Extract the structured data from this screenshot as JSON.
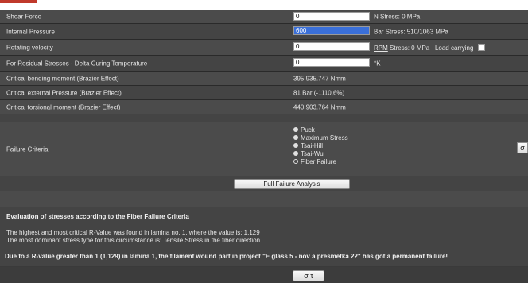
{
  "rows": {
    "shear_force": {
      "label": "Shear Force",
      "value": "0",
      "suffix": "N Stress: 0 MPa"
    },
    "internal_pressure": {
      "label": "Internal Pressure",
      "value": "600",
      "suffix": "Bar Stress: 510/1063 MPa"
    },
    "rotating_velocity": {
      "label": "Rotating velocity",
      "value": "0",
      "unit_link": "RPM",
      "suffix": "Stress: 0 MPa",
      "load_carrying": "Load carrying"
    },
    "residual": {
      "label": "For Residual Stresses - Delta Curing Temperature",
      "value": "0",
      "suffix": "°K"
    },
    "crit_bending": {
      "label": "Critical bending moment (Brazier Effect)",
      "value": "395.935.747 Nmm"
    },
    "crit_pressure": {
      "label": "Critical external Pressure (Brazier Effect)",
      "value": "81 Bar (-1110,6%)"
    },
    "crit_torsional": {
      "label": "Critical torsional moment (Brazier Effect)",
      "value": "440.903.764 Nmm"
    }
  },
  "failure": {
    "label": "Failure Criteria",
    "options": [
      "Puck",
      "Maximum Stress",
      "Tsai-Hill",
      "Tsai-Wu",
      "Fiber Failure"
    ],
    "side_button": "σ"
  },
  "analysis_button": "Full Failure Analysis",
  "evaluation": {
    "heading": "Evaluation of stresses according to the Fiber Failure Criteria",
    "line1": "The highest and most critical R-Value was found in lamina no. 1, where the value is: 1,129",
    "line2": "The most dominant stress type for this circumstance is: Tensile Stress in the fiber direction",
    "conclusion": "Due to a R-value greater than 1 (1,129) in lamina 1, the filament wound part in project \"E glass 5 - nov a presmetka 22\" has got a permanent failure!"
  },
  "bottom_button": "σ τ"
}
